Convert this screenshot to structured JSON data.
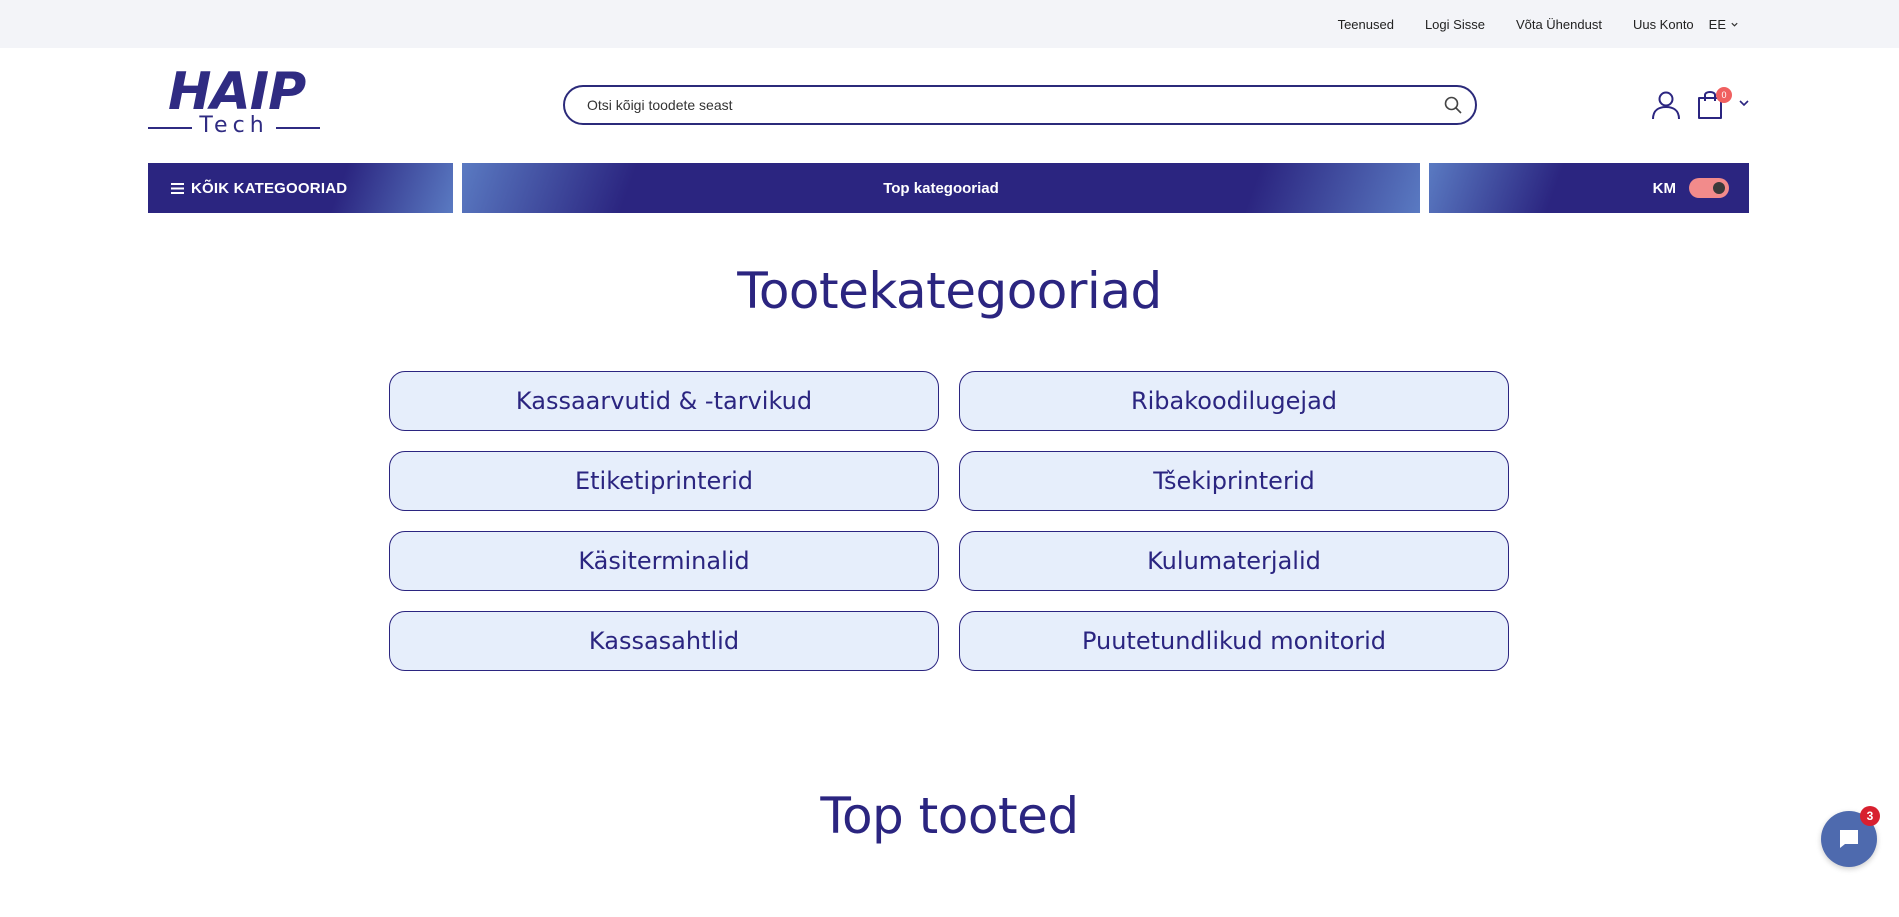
{
  "topbar": {
    "links": [
      "Teenused",
      "Logi Sisse",
      "Võta Ühendust",
      "Uus Konto"
    ],
    "language": "EE"
  },
  "logo": {
    "main": "HAIP",
    "sub": "Tech"
  },
  "search": {
    "placeholder": "Otsi kõigi toodete seast"
  },
  "cart": {
    "count": "0"
  },
  "nav": {
    "all_categories": "KÕIK KATEGOORIAD",
    "top_categories": "Top kategooriad",
    "km_label": "KM"
  },
  "categories_section": {
    "title": "Tootekategooriad",
    "items": [
      "Kassaarvutid & -tarvikud",
      "Ribakoodilugejad",
      "Etiketiprinterid",
      "Tšekiprinterid",
      "Käsiterminalid",
      "Kulumaterjalid",
      "Kassasahtlid",
      "Puutetundlikud monitorid"
    ]
  },
  "top_products": {
    "title": "Top tooted"
  },
  "chat": {
    "badge": "3"
  },
  "colors": {
    "primary": "#2b2580",
    "accent": "#5a7ac2",
    "category_bg": "#e6eefb",
    "toggle": "#f28b8b",
    "badge_red": "#d8202f"
  }
}
